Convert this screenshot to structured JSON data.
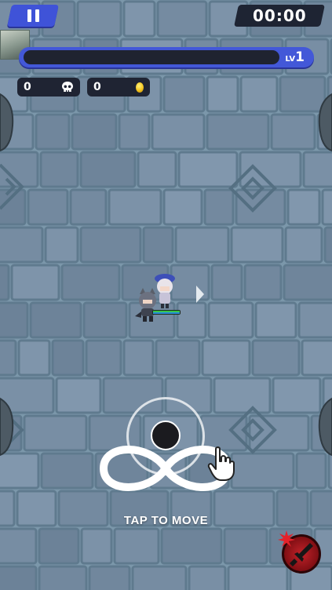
{
  "hud": {
    "pause_icon": "pause-icon",
    "timer": "00:00",
    "level_prefix": "LV",
    "level": "1",
    "xp_progress": 0,
    "kills": "0",
    "coins": "0",
    "skull_icon": "skull-icon",
    "coin_icon": "coin-icon"
  },
  "tutorial": {
    "instruction": "TAP TO MOVE"
  },
  "skill": {
    "icon": "sword-icon"
  },
  "colors": {
    "accent_blue": "#3f53d8",
    "hud_dark": "#1f2433",
    "floor_stone": "#7d98ab",
    "skill_red": "#c12229",
    "hp_green": "#36c44a"
  }
}
